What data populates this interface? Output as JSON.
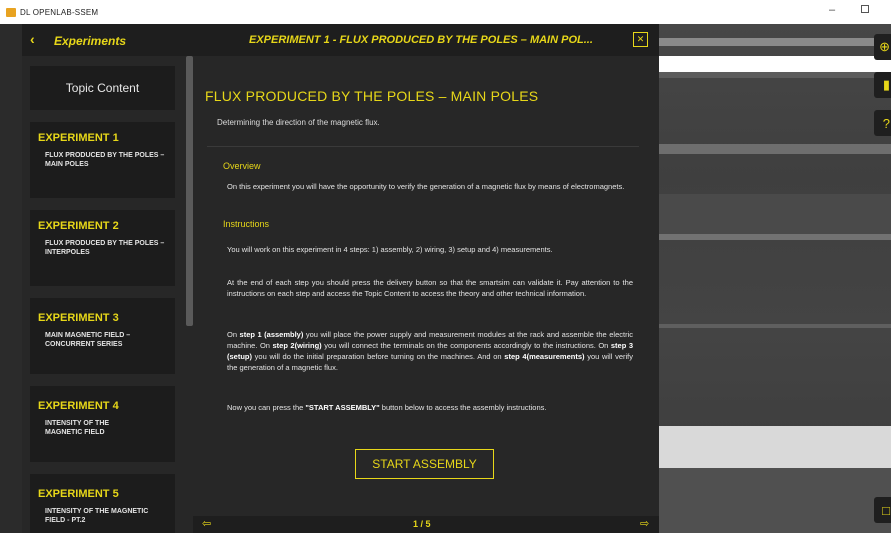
{
  "window": {
    "title": "DL OPENLAB-SSEM",
    "minimize": "–"
  },
  "left_panel": {
    "back_label": "Experiments",
    "topic_content": "Topic Content",
    "experiments": [
      {
        "title": "EXPERIMENT 1",
        "subtitle": "FLUX PRODUCED BY THE POLES – MAIN POLES"
      },
      {
        "title": "EXPERIMENT 2",
        "subtitle": "FLUX PRODUCED BY THE POLES – INTERPOLES"
      },
      {
        "title": "EXPERIMENT 3",
        "subtitle": "MAIN MAGNETIC FIELD – CONCURRENT SERIES"
      },
      {
        "title": "EXPERIMENT 4",
        "subtitle": "INTENSITY OF THE MAGNETIC FIELD"
      },
      {
        "title": "EXPERIMENT 5",
        "subtitle": "INTENSITY OF THE MAGNETIC FIELD - PT.2"
      }
    ]
  },
  "main_panel": {
    "header_title": "EXPERIMENT 1 - FLUX PRODUCED BY THE POLES – MAIN POL...",
    "heading": "FLUX PRODUCED BY THE POLES – MAIN POLES",
    "lead": "Determining the direction of the magnetic flux.",
    "overview_title": "Overview",
    "overview_text": "On this experiment you will have the opportunity to verify the generation of a magnetic flux by means of electromagnets.",
    "instructions_title": "Instructions",
    "instructions_p1": "You will work on this experiment in 4 steps: 1) assembly, 2) wiring, 3) setup and 4) measurements.",
    "instructions_p2": "At the end of each step you should press the delivery button so that the smartsim can validate it. Pay attention to the instructions on each step and access the Topic Content to access the theory and other technical information.",
    "steps": {
      "t1": "On ",
      "s1": "step 1 (assembly)",
      "t2": " you will place the power supply and measurement modules at the rack and assemble the electric machine. On ",
      "s2": "step 2(wiring)",
      "t3": " you will connect the terminals on the components accordingly to the instructions. On ",
      "s3": "step 3 (setup)",
      "t4": " you will do the initial preparation before turning on the machines. And on ",
      "s4": "step 4(measurements)",
      "t5": " you will verify the generation of a magnetic flux."
    },
    "final": {
      "t1": "Now you can press the ",
      "b": "\"START ASSEMBLY\"",
      "t2": " button below  to access the assembly instructions."
    },
    "start_button": "START ASSEMBLY",
    "page": "1 / 5"
  },
  "icons": {
    "back": "chevron-left-icon",
    "close": "close-icon",
    "prev": "arrow-left-icon",
    "next": "arrow-right-icon",
    "toolbar": [
      "globe-icon",
      "chart-icon",
      "help-icon",
      "window-icon"
    ]
  },
  "colors": {
    "accent": "#e7d719",
    "panel": "#272727",
    "header": "#1e1e1e",
    "card": "#1c1c1c"
  }
}
